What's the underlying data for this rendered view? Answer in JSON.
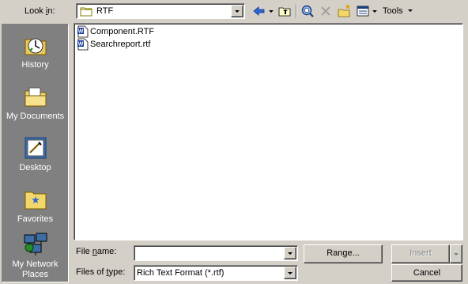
{
  "look_in": {
    "label": "Look in:",
    "value": "RTF"
  },
  "toolbar": {
    "back": "back-arrow-icon",
    "up": "up-folder-icon",
    "search_web": "search-web-icon",
    "delete": "delete-icon",
    "new_folder": "new-folder-icon",
    "views": "views-icon",
    "tools_label": "Tools"
  },
  "places": [
    {
      "label": "History",
      "icon": "history-icon"
    },
    {
      "label": "My Documents",
      "icon": "my-documents-icon"
    },
    {
      "label": "Desktop",
      "icon": "desktop-icon"
    },
    {
      "label": "Favorites",
      "icon": "favorites-icon"
    },
    {
      "label_line1": "My Network",
      "label_line2": "Places",
      "icon": "network-places-icon"
    }
  ],
  "files": [
    {
      "name": "Component.RTF",
      "icon": "word-document-icon"
    },
    {
      "name": "Searchreport.rtf",
      "icon": "word-document-icon"
    }
  ],
  "file_name": {
    "label": "File name:",
    "value": ""
  },
  "files_of_type": {
    "label": "Files of type:",
    "value": "Rich Text Format (*.rtf)"
  },
  "buttons": {
    "range": "Range...",
    "insert": "Insert",
    "cancel": "Cancel"
  },
  "colors": {
    "dialog_bg": "#d4d0c8",
    "places_bg": "#808080",
    "list_bg": "#ffffff"
  }
}
